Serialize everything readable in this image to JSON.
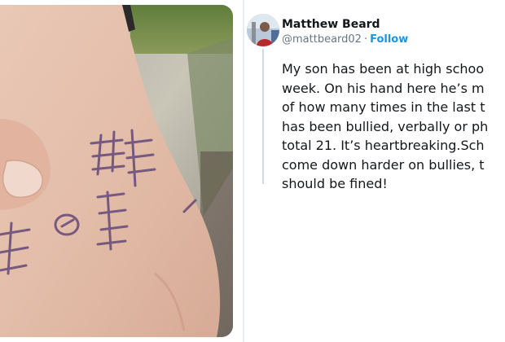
{
  "photo": {
    "description_icon": "hand-tally-photo"
  },
  "tweet": {
    "author_name": "Matthew Beard",
    "handle": "@mattbeard02",
    "separator": "·",
    "follow_label": "Follow",
    "text_lines": [
      "My son has been at high schoo",
      "week. On his hand here he’s m",
      "of how many times in the last t",
      "has been bullied, verbally or ph",
      "total 21. It’s heartbreaking.Sch",
      "come down harder on bullies, t",
      "should be fined!"
    ]
  },
  "colors": {
    "link": "#1b95e0",
    "text": "#14171a",
    "meta": "#657786"
  }
}
